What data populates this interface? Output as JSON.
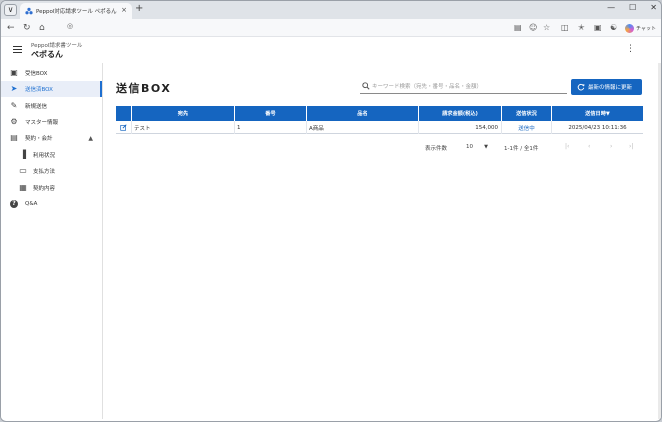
{
  "browser": {
    "tab_title": "Peppol対応請求ツール ペポるん",
    "tab_close": "×",
    "newtab": "+",
    "menu": "∨",
    "win_min": "—",
    "win_max": "☐",
    "win_close": "✕",
    "chat_label": "チャット",
    "accent": "#1e6fd0"
  },
  "app": {
    "subtitle": "Peppol請求書ツール",
    "title": "ペポるん",
    "kebab": "⋮"
  },
  "sidebar": {
    "items": [
      {
        "label": "受信BOX",
        "icon": "inbox-icon",
        "glyph": "▣"
      },
      {
        "label": "送信済BOX",
        "icon": "send-icon",
        "glyph": "➤"
      },
      {
        "label": "新規送信",
        "icon": "pencil-icon",
        "glyph": "✎"
      },
      {
        "label": "マスター情報",
        "icon": "gear-icon",
        "glyph": "⚙"
      },
      {
        "label": "契約・会計",
        "icon": "wallet-icon",
        "glyph": "▤",
        "caret": "▲"
      },
      {
        "label": "利用状況",
        "icon": "bar-chart-icon",
        "glyph": "▐"
      },
      {
        "label": "支払方法",
        "icon": "card-icon",
        "glyph": "▭"
      },
      {
        "label": "契約内容",
        "icon": "dashboard-icon",
        "glyph": "▦"
      },
      {
        "label": "Q&A",
        "icon": "help-icon",
        "glyph": "?"
      }
    ]
  },
  "main": {
    "page_title": "送信BOX",
    "search_placeholder": "キーワード検索（宛先・番号・品名・金額）",
    "refresh_label": "最新の情報に更新",
    "table": {
      "headers": [
        "",
        "宛先",
        "番号",
        "品名",
        "請求金額(税込)",
        "送信状況",
        "送信日時▼"
      ],
      "rows": [
        {
          "recipient": "テスト",
          "number": "1",
          "item": "A商品",
          "amount": "154,000",
          "status": "送信中",
          "datetime": "2025/04/23 10:11:36"
        }
      ]
    },
    "pager": {
      "rows_label": "表示件数",
      "rows_value": "10",
      "range": "1-1件 / 全1件",
      "first": "|‹",
      "prev": "‹",
      "next": "›",
      "last": "›|"
    }
  }
}
